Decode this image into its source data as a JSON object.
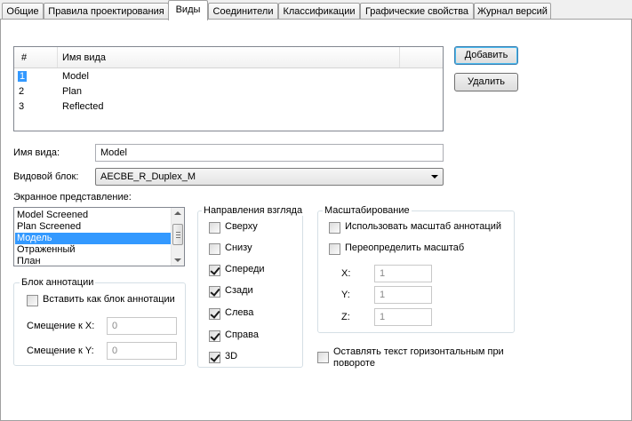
{
  "tabs": [
    {
      "label": "Общие"
    },
    {
      "label": "Правила проектирования"
    },
    {
      "label": "Виды"
    },
    {
      "label": "Соединители"
    },
    {
      "label": "Классификации"
    },
    {
      "label": "Графические свойства"
    },
    {
      "label": "Журнал версий"
    }
  ],
  "active_tab": "Виды",
  "views_list": {
    "columns": [
      "#",
      "Имя вида"
    ],
    "rows": [
      {
        "num": "1",
        "name": "Model"
      },
      {
        "num": "2",
        "name": "Plan"
      },
      {
        "num": "3",
        "name": "Reflected"
      }
    ],
    "selected_row": 0
  },
  "buttons": {
    "add": "Добавить",
    "delete": "Удалить"
  },
  "view_name": {
    "label": "Имя вида:",
    "value": "Model"
  },
  "view_block": {
    "label": "Видовой блок:",
    "value": "AECBE_R_Duplex_M"
  },
  "display_rep": {
    "label": "Экранное представление:",
    "items": [
      "Model Screened",
      "Plan Screened",
      "Модель",
      "Отраженный",
      "План"
    ],
    "selected_index": 2
  },
  "annotation_block": {
    "title": "Блок аннотации",
    "insert_as_annotation": {
      "label": "Вставить как блок аннотации",
      "checked": false
    },
    "offset_x": {
      "label": "Смещение к X:",
      "value": "0"
    },
    "offset_y": {
      "label": "Смещение к Y:",
      "value": "0"
    }
  },
  "view_directions": {
    "title": "Направления взгляда",
    "items": [
      {
        "label": "Сверху",
        "checked": false
      },
      {
        "label": "Снизу",
        "checked": false
      },
      {
        "label": "Спереди",
        "checked": true
      },
      {
        "label": "Сзади",
        "checked": true
      },
      {
        "label": "Слева",
        "checked": true
      },
      {
        "label": "Справа",
        "checked": true
      },
      {
        "label": "3D",
        "checked": true
      }
    ]
  },
  "scaling": {
    "title": "Масштабирование",
    "use_annotation_scale": {
      "label": "Использовать масштаб аннотаций",
      "checked": false
    },
    "override_scale": {
      "label": "Переопределить масштаб",
      "checked": false
    },
    "x": {
      "label": "X:",
      "value": "1"
    },
    "y": {
      "label": "Y:",
      "value": "1"
    },
    "z": {
      "label": "Z:",
      "value": "1"
    }
  },
  "keep_text_horizontal": {
    "label": "Оставлять текст горизонтальным при повороте",
    "checked": false
  }
}
